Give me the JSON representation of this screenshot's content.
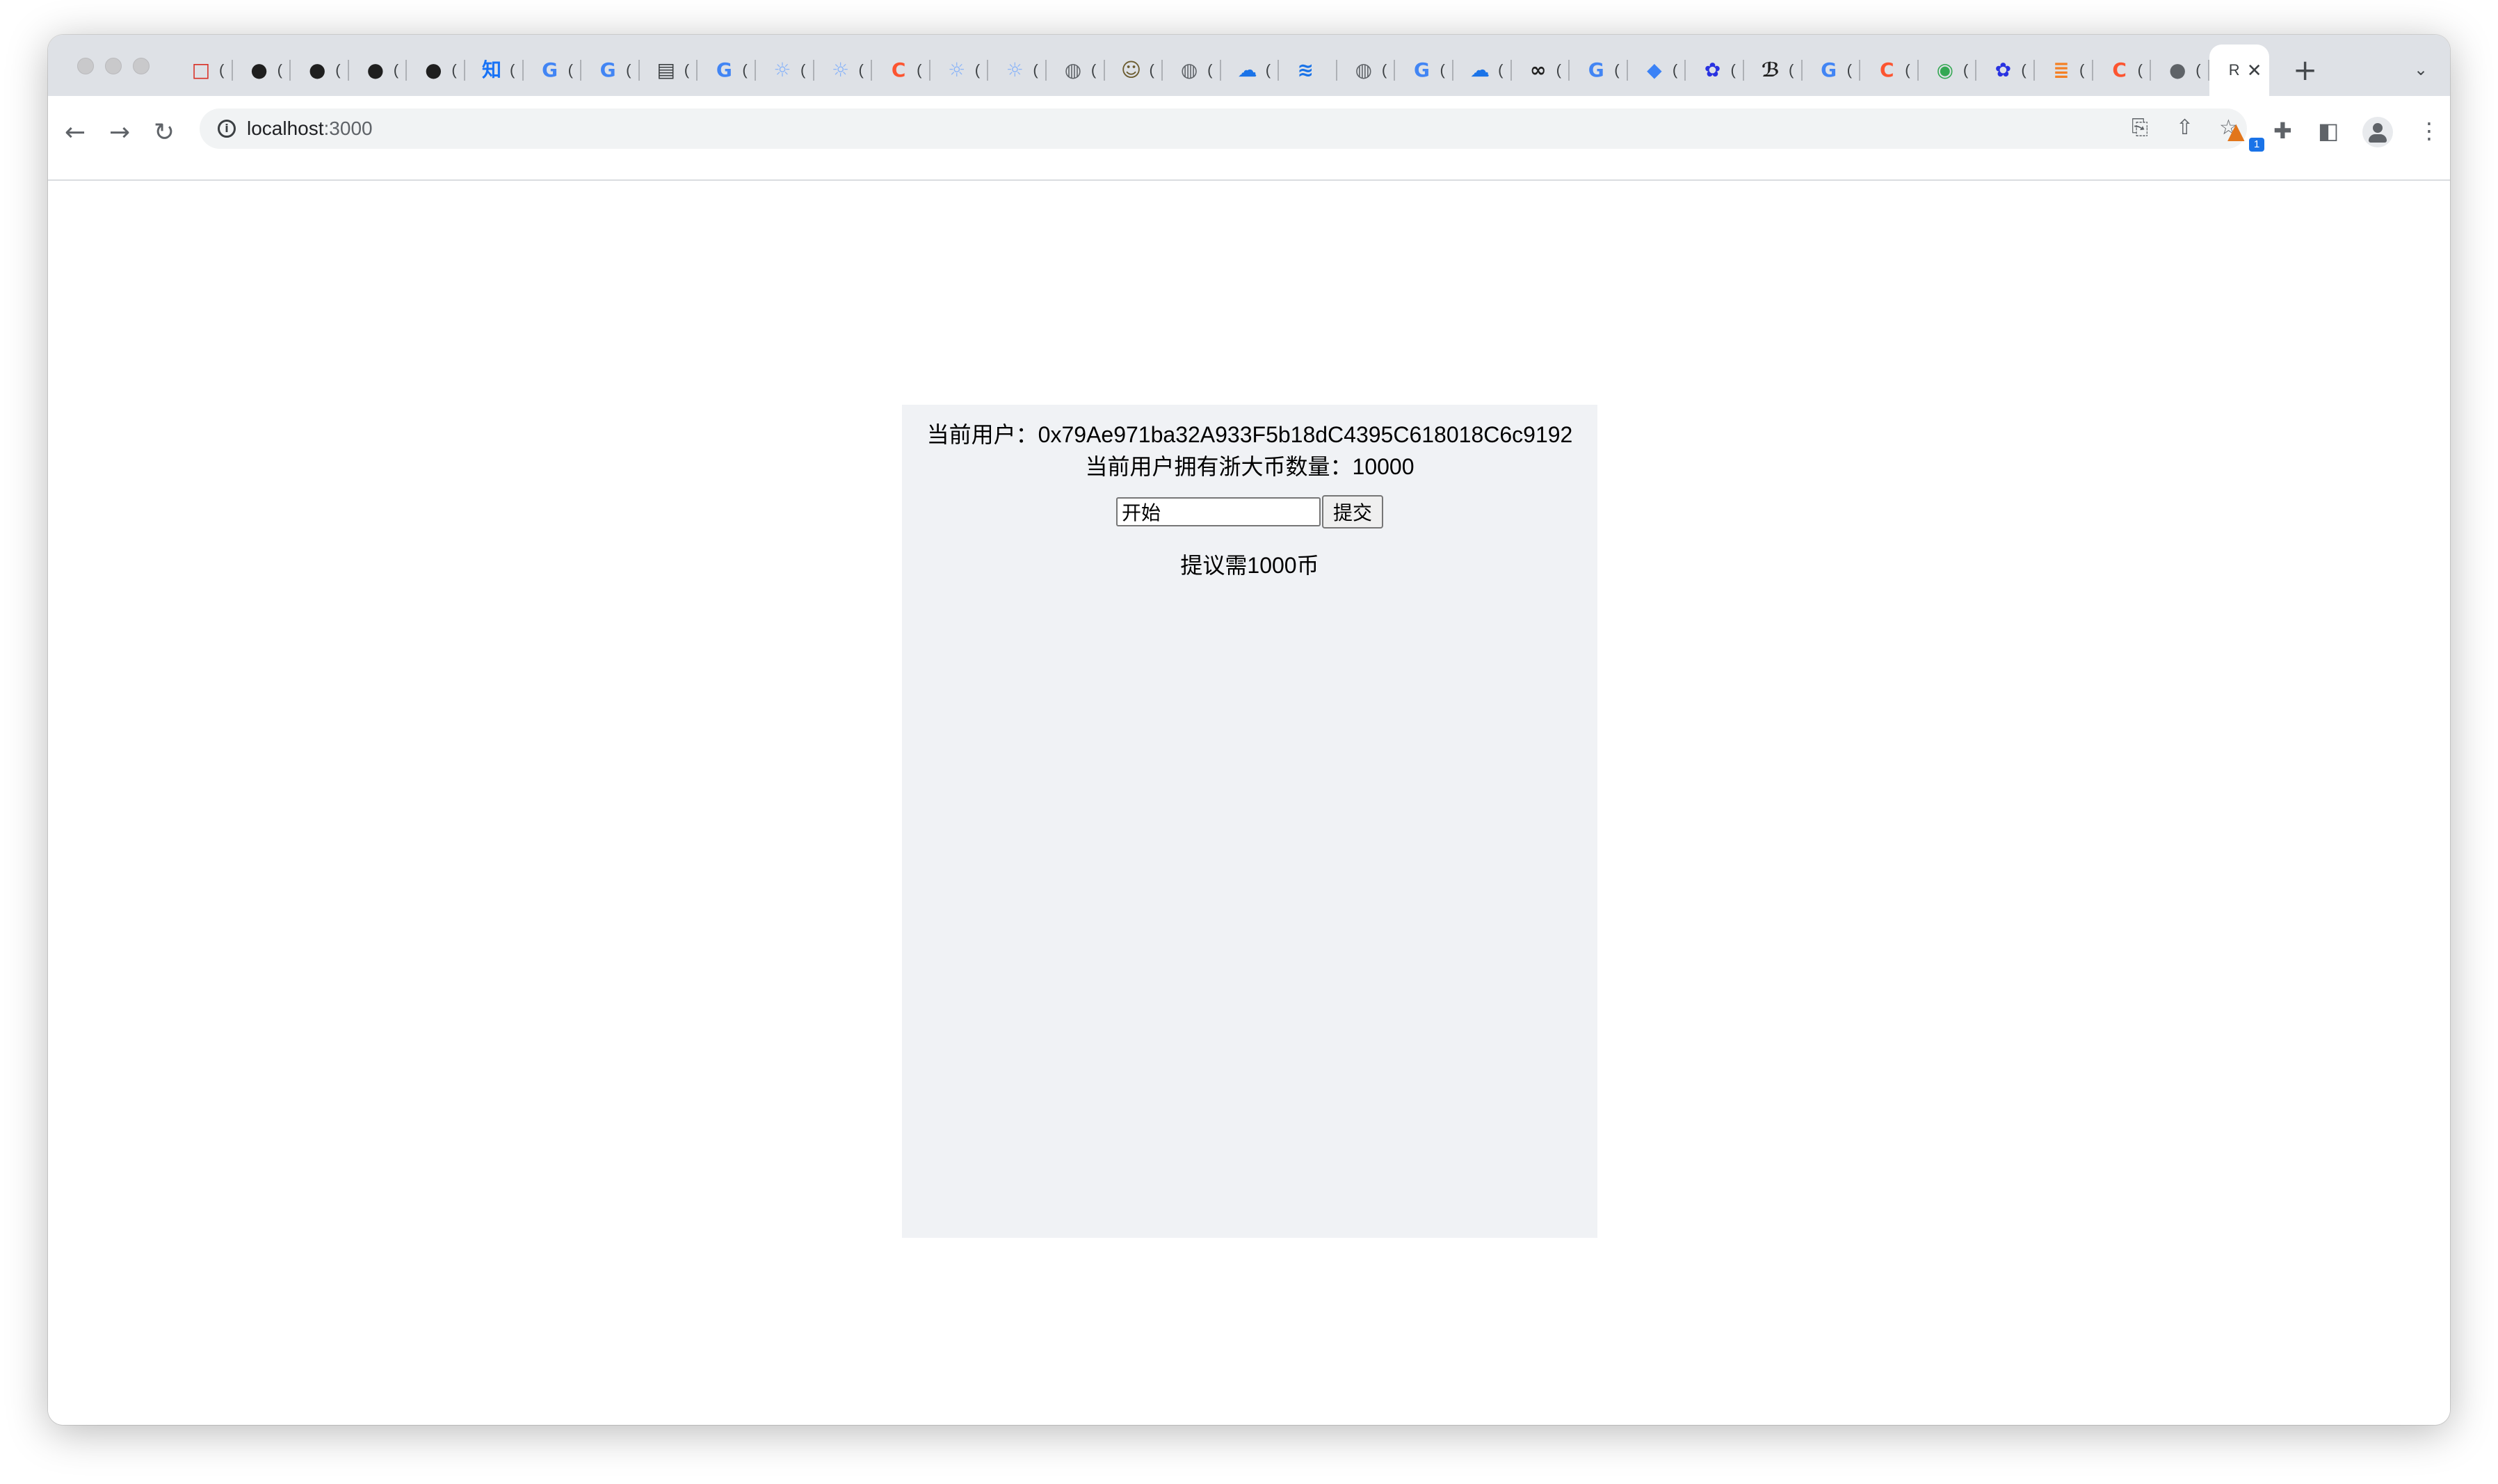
{
  "browser": {
    "tabs": [
      {
        "label": "(",
        "icon": "red-square-icon",
        "color": "#d93025",
        "glyph": "□"
      },
      {
        "label": "(",
        "icon": "github-icon",
        "color": "#1f1f1f",
        "glyph": "●"
      },
      {
        "label": "(",
        "icon": "github-icon",
        "color": "#1f1f1f",
        "glyph": "●"
      },
      {
        "label": "(",
        "icon": "github-icon",
        "color": "#1f1f1f",
        "glyph": "●"
      },
      {
        "label": "(",
        "icon": "github-icon",
        "color": "#1f1f1f",
        "glyph": "●"
      },
      {
        "label": "(",
        "icon": "zhihu-icon",
        "color": "#1772f6",
        "glyph": "知"
      },
      {
        "label": "(",
        "icon": "google-icon",
        "color": "#4285f4",
        "glyph": "G"
      },
      {
        "label": "(",
        "icon": "google-icon",
        "color": "#4285f4",
        "glyph": "G"
      },
      {
        "label": "(",
        "icon": "book-icon",
        "color": "#3c4043",
        "glyph": "▤"
      },
      {
        "label": "(",
        "icon": "google-icon",
        "color": "#4285f4",
        "glyph": "G"
      },
      {
        "label": "(",
        "icon": "bulb-icon",
        "color": "#8ab4f8",
        "glyph": "☼"
      },
      {
        "label": "(",
        "icon": "bulb-icon",
        "color": "#8ab4f8",
        "glyph": "☼"
      },
      {
        "label": "(",
        "icon": "csdn-icon",
        "color": "#fc5531",
        "glyph": "C"
      },
      {
        "label": "(",
        "icon": "bulb-icon",
        "color": "#8ab4f8",
        "glyph": "☼"
      },
      {
        "label": "(",
        "icon": "bulb-icon",
        "color": "#8ab4f8",
        "glyph": "☼"
      },
      {
        "label": "(",
        "icon": "globe-icon",
        "color": "#5f6368",
        "glyph": "◍"
      },
      {
        "label": "(",
        "icon": "avatar-icon",
        "color": "#6b5b2e",
        "glyph": "☺"
      },
      {
        "label": "(",
        "icon": "globe-icon",
        "color": "#5f6368",
        "glyph": "◍"
      },
      {
        "label": "(",
        "icon": "cloud-icon",
        "color": "#1a73e8",
        "glyph": "☁"
      },
      {
        "label": "",
        "icon": "layers-icon",
        "color": "#1a73e8",
        "glyph": "≋"
      },
      {
        "label": "(",
        "icon": "globe-icon",
        "color": "#5f6368",
        "glyph": "◍"
      },
      {
        "label": "(",
        "icon": "google-icon",
        "color": "#4285f4",
        "glyph": "G"
      },
      {
        "label": "(",
        "icon": "cloud-icon",
        "color": "#1a73e8",
        "glyph": "☁"
      },
      {
        "label": "(",
        "icon": "co-icon",
        "color": "#1f1f1f",
        "glyph": "∞"
      },
      {
        "label": "(",
        "icon": "google-icon",
        "color": "#4285f4",
        "glyph": "G"
      },
      {
        "label": "(",
        "icon": "diamond-icon",
        "color": "#3b82f6",
        "glyph": "◆"
      },
      {
        "label": "(",
        "icon": "baidu-icon",
        "color": "#2932e1",
        "glyph": "✿"
      },
      {
        "label": "(",
        "icon": "feather-icon",
        "color": "#1f1f1f",
        "glyph": "ℬ"
      },
      {
        "label": "(",
        "icon": "google-icon",
        "color": "#4285f4",
        "glyph": "G"
      },
      {
        "label": "(",
        "icon": "csdn-icon",
        "color": "#fc5531",
        "glyph": "C"
      },
      {
        "label": "(",
        "icon": "green-circle-icon",
        "color": "#34a853",
        "glyph": "◉"
      },
      {
        "label": "(",
        "icon": "baidu-icon",
        "color": "#2932e1",
        "glyph": "✿"
      },
      {
        "label": "(",
        "icon": "stack-icon",
        "color": "#f48024",
        "glyph": "≣"
      },
      {
        "label": "(",
        "icon": "csdn-icon",
        "color": "#fc5531",
        "glyph": "C"
      },
      {
        "label": "(",
        "icon": "apple-icon",
        "color": "#5f6368",
        "glyph": "●"
      }
    ],
    "active_tab": {
      "label": "R",
      "close": "✕"
    },
    "new_tab": "+",
    "address": {
      "host": "localhost",
      "port": ":3000"
    }
  },
  "app": {
    "user_label": "当前用户：",
    "user_address": "0x79Ae971ba32A933F5b18dC4395C618018C6c9192",
    "balance_label": "当前用户拥有浙大币数量：",
    "balance_value": "10000",
    "proposal_input_value": "开始",
    "submit_label": "提交",
    "proposal_note": "提议需1000币"
  }
}
